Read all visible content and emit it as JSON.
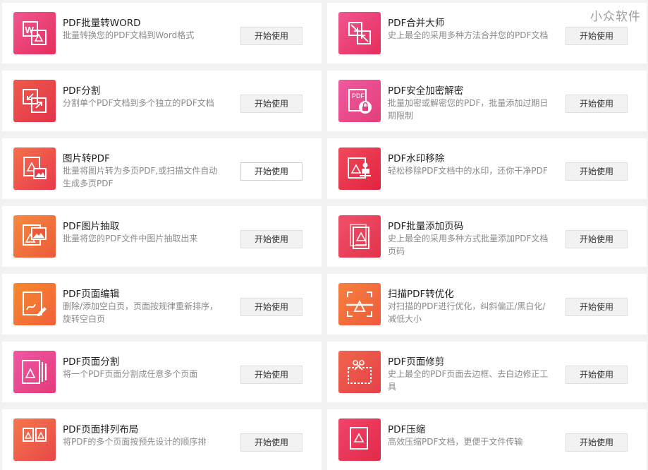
{
  "watermark": "小众软件",
  "colors": {
    "icon_red": "#e8334f",
    "icon_pink": "#ec4b8c",
    "icon_orange": "#f3743a"
  },
  "tools": [
    {
      "title": "PDF批量转WORD",
      "desc": "批量转换您的PDF文档到Word格式",
      "button": "开始使用",
      "icon": "word-convert-icon"
    },
    {
      "title": "PDF合并大师",
      "desc": "史上最全的采用多种方法合并您的PDF文档",
      "button": "开始使用",
      "icon": "merge-icon"
    },
    {
      "title": "PDF分割",
      "desc": "分割单个PDF文档到多个独立的PDF文档",
      "button": "开始使用",
      "icon": "split-icon"
    },
    {
      "title": "PDF安全加密解密",
      "desc": "批量加密或解密您的PDF，批量添加过期日期限制",
      "button": "开始使用",
      "icon": "lock-icon"
    },
    {
      "title": "图片转PDF",
      "desc": "批量将图片转为多页PDF,或扫描文件自动生成多页PDF",
      "button": "开始使用",
      "icon": "image-to-pdf-icon"
    },
    {
      "title": "PDF水印移除",
      "desc": "轻松移除PDF文档中的水印，还你干净PDF",
      "button": "开始使用",
      "icon": "watermark-remove-icon"
    },
    {
      "title": "PDF图片抽取",
      "desc": "批量将您的PDF文件中图片抽取出来",
      "button": "开始使用",
      "icon": "image-extract-icon"
    },
    {
      "title": "PDF批量添加页码",
      "desc": "史上最全的采用多种方式批量添加PDF文档页码",
      "button": "开始使用",
      "icon": "page-number-icon"
    },
    {
      "title": "PDF页面编辑",
      "desc": "删除/添加空白页，页面按规律重新排序，旋转空白页",
      "button": "开始使用",
      "icon": "page-edit-icon"
    },
    {
      "title": "扫描PDF转优化",
      "desc": "对扫描的PDF进行优化，纠斜偏正/黑白化/减低大小",
      "button": "开始使用",
      "icon": "scan-optimize-icon"
    },
    {
      "title": "PDF页面分割",
      "desc": "将一个PDF页面分割成任意多个页面",
      "button": "开始使用",
      "icon": "page-split-icon"
    },
    {
      "title": "PDF页面修剪",
      "desc": "史上最全的PDF页面去边框、去白边修正工具",
      "button": "开始使用",
      "icon": "crop-icon"
    },
    {
      "title": "PDF页面排列布局",
      "desc": "将PDF的多个页面按预先设计的顺序排",
      "button": "开始使用",
      "icon": "layout-icon"
    },
    {
      "title": "PDF压缩",
      "desc": "高效压缩PDF文档，更便于文件传输",
      "button": "开始使用",
      "icon": "compress-icon"
    }
  ]
}
